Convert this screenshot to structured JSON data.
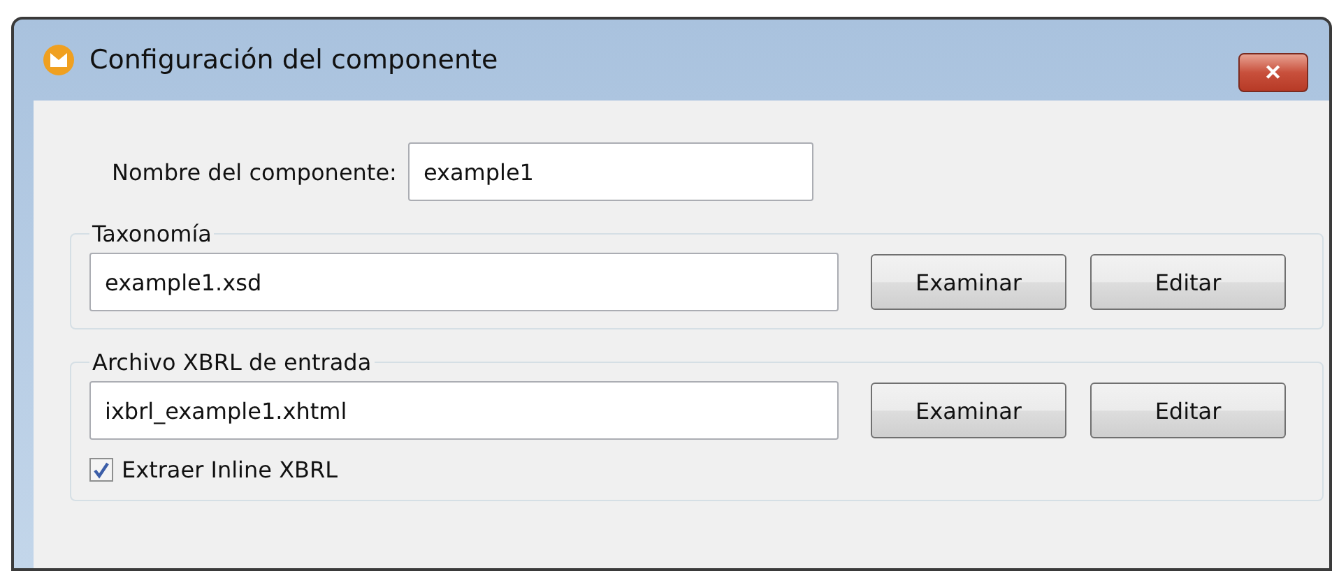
{
  "window": {
    "title": "Configuración del componente",
    "close": "✕"
  },
  "name_field": {
    "label": "Nombre del componente:",
    "value": "example1"
  },
  "groups": [
    {
      "legend": "Taxonomía",
      "value": "example1.xsd",
      "buttons": [
        "Examinar",
        "Editar"
      ]
    },
    {
      "legend": "Archivo XBRL de entrada",
      "value": "ixbrl_example1.xhtml",
      "buttons": [
        "Examinar",
        "Editar"
      ],
      "checkbox": {
        "label": "Extraer Inline XBRL",
        "checked": true
      }
    }
  ]
}
